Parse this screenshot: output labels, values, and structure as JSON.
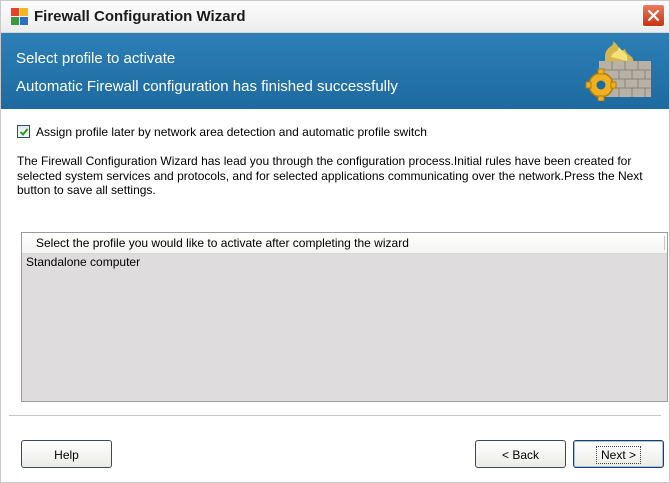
{
  "window": {
    "title": "Firewall Configuration Wizard"
  },
  "banner": {
    "title": "Select profile to activate",
    "subtitle": "Automatic Firewall configuration has finished successfully"
  },
  "options": {
    "assign_later_label": "Assign profile later by network area detection and automatic profile switch",
    "assign_later_checked": true
  },
  "description": "The Firewall Configuration Wizard has lead you through the configuration process.Initial rules have been created for selected system services and protocols, and for selected applications communicating over the network.Press the Next button to save all settings.",
  "profile_list": {
    "header": "Select the profile you would like to activate after completing the wizard",
    "items": [
      "Standalone computer"
    ]
  },
  "buttons": {
    "help": "Help",
    "back": "< Back",
    "next": "Next >"
  },
  "colors": {
    "banner": "#2273ac",
    "list_background": "#dedcdd",
    "close_button": "#d4462a"
  }
}
